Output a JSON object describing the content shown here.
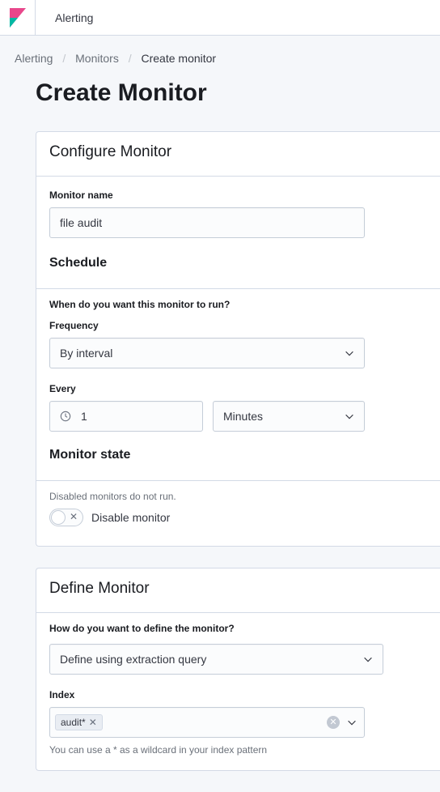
{
  "header": {
    "app_title": "Alerting"
  },
  "breadcrumbs": {
    "items": [
      "Alerting",
      "Monitors",
      "Create monitor"
    ]
  },
  "page": {
    "title": "Create Monitor"
  },
  "configure": {
    "title": "Configure Monitor",
    "monitor_name_label": "Monitor name",
    "monitor_name_value": "file audit",
    "schedule_title": "Schedule",
    "schedule_prompt": "When do you want this monitor to run?",
    "frequency_label": "Frequency",
    "frequency_value": "By interval",
    "every_label": "Every",
    "every_value": "1",
    "every_unit": "Minutes",
    "state_title": "Monitor state",
    "state_hint": "Disabled monitors do not run.",
    "toggle_label": "Disable monitor"
  },
  "define": {
    "title": "Define Monitor",
    "prompt": "How do you want to define the monitor?",
    "method_value": "Define using extraction query",
    "index_label": "Index",
    "index_pill": "audit*",
    "index_help": "You can use a * as a wildcard in your index pattern"
  }
}
